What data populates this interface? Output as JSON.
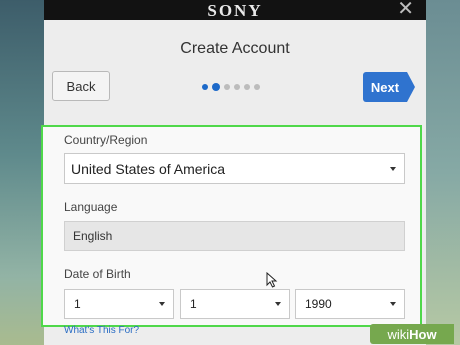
{
  "header": {
    "brand": "SONY",
    "close_glyph": "✕"
  },
  "page": {
    "title": "Create Account"
  },
  "nav": {
    "back_label": "Back",
    "next_label": "Next",
    "steps_total": 6,
    "current_step": 2
  },
  "form": {
    "country_label": "Country/Region",
    "country_value": "United States of America",
    "language_label": "Language",
    "language_value": "English",
    "dob_label": "Date of Birth",
    "dob_month": "1",
    "dob_day": "1",
    "dob_year": "1990"
  },
  "footer": {
    "help_link": "What's This For?"
  },
  "watermark": {
    "part1": "wiki",
    "part2": "How"
  },
  "colors": {
    "accent": "#2f73cf",
    "highlight": "#4fd84a",
    "topbar": "#121212"
  }
}
